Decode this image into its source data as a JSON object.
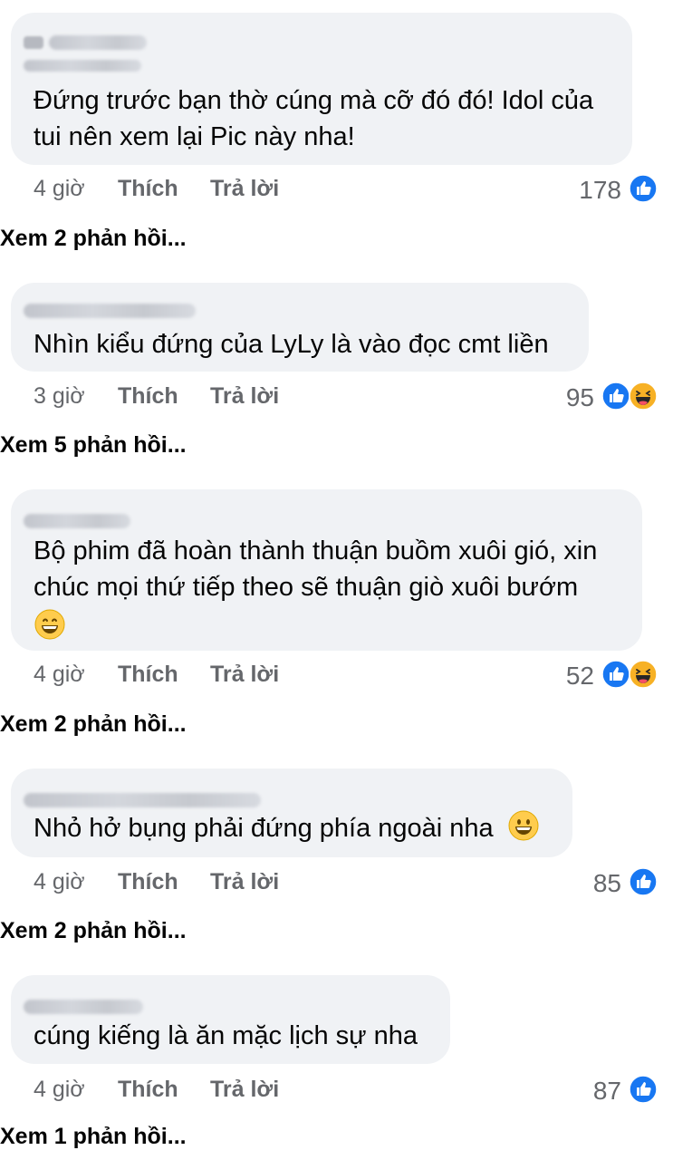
{
  "comments": [
    {
      "text_lines": [
        "Đứng trước bạn thờ cúng mà cỡ đó đó! Idol của",
        "tui nên xem lại Pic này nha!"
      ],
      "time": "4 giờ",
      "like_label": "Thích",
      "reply_label": "Trả lời",
      "reaction_count": "178",
      "reactions": [
        "like-icon"
      ],
      "view_replies": "Xem 2 phản hồi..."
    },
    {
      "text_lines": [
        "Nhìn kiểu đứng của LyLy là vào đọc cmt liền"
      ],
      "time": "3 giờ",
      "like_label": "Thích",
      "reply_label": "Trả lời",
      "reaction_count": "95",
      "reactions": [
        "like-icon",
        "haha-icon"
      ],
      "view_replies": "Xem 5 phản hồi..."
    },
    {
      "text_lines": [
        "Bộ phim đã hoàn thành thuận buồm xuôi gió, xin",
        "chúc mọi thứ tiếp theo sẽ thuận giò xuôi bướm"
      ],
      "time": "4 giờ",
      "like_label": "Thích",
      "reply_label": "Trả lời",
      "reaction_count": "52",
      "reactions": [
        "like-icon",
        "haha-icon"
      ],
      "view_replies": "Xem 2 phản hồi..."
    },
    {
      "text_lines": [
        "Nhỏ hở bụng phải đứng phía ngoài nha"
      ],
      "time": "4 giờ",
      "like_label": "Thích",
      "reply_label": "Trả lời",
      "reaction_count": "85",
      "reactions": [
        "like-icon"
      ],
      "view_replies": "Xem 2 phản hồi..."
    },
    {
      "text_lines": [
        "cúng kiếng là ăn mặc lịch sự nha"
      ],
      "time": "4 giờ",
      "like_label": "Thích",
      "reply_label": "Trả lời",
      "reaction_count": "87",
      "reactions": [
        "like-icon"
      ],
      "view_replies": "Xem 1 phản hồi..."
    }
  ],
  "colors": {
    "bubble": "#f0f2f5",
    "meta_text": "#65676b",
    "like_blue": "#1877f2",
    "haha_yellow": "#f7b125"
  }
}
